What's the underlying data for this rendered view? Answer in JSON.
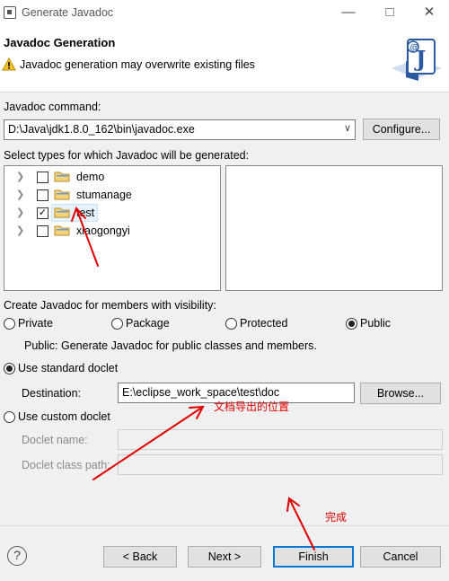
{
  "window": {
    "title": "Generate Javadoc"
  },
  "header": {
    "title": "Javadoc Generation",
    "message": "Javadoc generation may overwrite existing files"
  },
  "command": {
    "label": "Javadoc command:",
    "value": "D:\\Java\\jdk1.8.0_162\\bin\\javadoc.exe",
    "configure_label": "Configure..."
  },
  "types": {
    "label": "Select types for which Javadoc will be generated:",
    "projects": [
      {
        "name": "demo",
        "checked": false
      },
      {
        "name": "stumanage",
        "checked": false
      },
      {
        "name": "test",
        "checked": true
      },
      {
        "name": "xiaogongyi",
        "checked": false
      }
    ]
  },
  "visibility": {
    "label": "Create Javadoc for members with visibility:",
    "options": [
      "Private",
      "Package",
      "Protected",
      "Public"
    ],
    "selected": "Public",
    "description": "Public: Generate Javadoc for public classes and members."
  },
  "standard_doclet": {
    "label": "Use standard doclet",
    "destination_label": "Destination:",
    "destination_value": "E:\\eclipse_work_space\\test\\doc",
    "browse_label": "Browse..."
  },
  "custom_doclet": {
    "label": "Use custom doclet",
    "name_label": "Doclet name:",
    "classpath_label": "Doclet class path:"
  },
  "buttons": {
    "back": "< Back",
    "next": "Next >",
    "finish": "Finish",
    "cancel": "Cancel"
  },
  "annotations": {
    "destination_note": "文档导出的位置",
    "finish_note": "完成"
  },
  "colors": {
    "annotation": "#e00000",
    "default_button_border": "#0078d7"
  }
}
